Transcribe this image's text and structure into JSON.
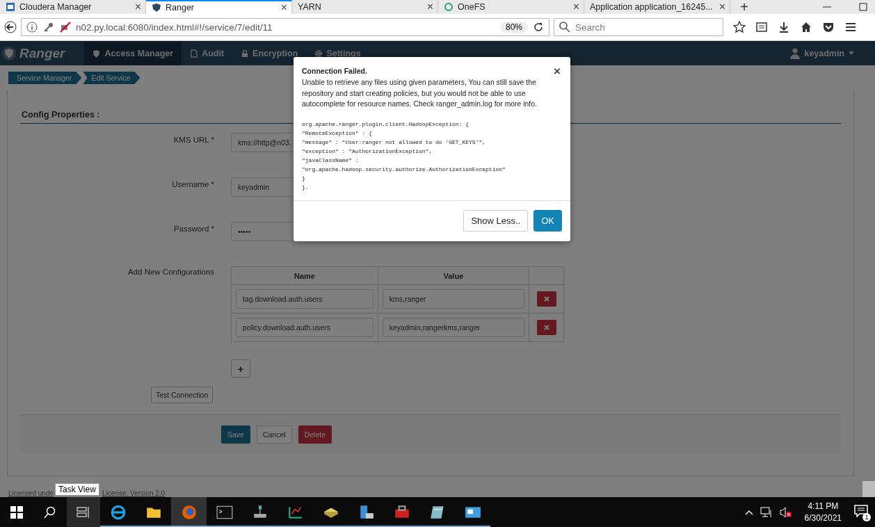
{
  "browser": {
    "tabs": [
      {
        "label": "Cloudera Manager",
        "selected": false,
        "close": "×"
      },
      {
        "label": "Ranger",
        "selected": true,
        "close": "×"
      },
      {
        "label": "YARN",
        "selected": false,
        "close": "×"
      },
      {
        "label": "OneFS",
        "selected": false,
        "close": "×"
      },
      {
        "label": "Application application_16245...",
        "selected": false,
        "close": "×"
      }
    ],
    "new_tab": "+",
    "url": "n02.py.local:6080/index.html#!/service/7/edit/11",
    "zoom": "80%",
    "search": {
      "placeholder": "Search"
    }
  },
  "navbar": {
    "brand": "Ranger",
    "items": [
      {
        "label": "Access Manager",
        "selected": true
      },
      {
        "label": "Audit",
        "selected": false
      },
      {
        "label": "Encryption",
        "selected": false
      },
      {
        "label": "Settings",
        "selected": false
      }
    ],
    "user": "keyadmin"
  },
  "breadcrumbs": [
    "Service Manager",
    "Edit Service"
  ],
  "section_title": "Config Properties :",
  "fields": [
    {
      "label": "KMS URL *",
      "value": "kms://http@n03."
    },
    {
      "label": "Username *",
      "value": "keyadmin"
    },
    {
      "label": "Password *",
      "value": "•••••"
    }
  ],
  "configs": {
    "label": "Add New Configurations",
    "columns": [
      "Name",
      "Value"
    ],
    "rows": [
      {
        "name": "tag.download.auth.users",
        "value": "kms,ranger"
      },
      {
        "name": "policy.download.auth.users",
        "value": "keyadmin,rangerkms,ranger"
      }
    ],
    "add": "+"
  },
  "test_connection": "Test Connection",
  "actions": [
    "Save",
    "Cancel",
    "Delete"
  ],
  "footer": [
    "Licensed unde",
    "License, Version 2.0"
  ],
  "modal": {
    "title": "Connection Failed.",
    "close": "×",
    "message": "Unable to retrieve any files using given parameters, You can still save the repository and start creating policies, but you would not be able to use autocomplete for resource names. Check ranger_admin.log for more info.",
    "details": [
      "org.apache.ranger.plugin.client.HadoopException: {",
      "\"RemoteException\" : {",
      "\"message\" : \"User:ranger not allowed to do 'GET_KEYS'\",",
      "\"exception\" : \"AuthorizationException\",",
      "\"javaClassName\" : ",
      "\"org.apache.hadoop.security.authorize.AuthorizationException\"",
      "}",
      "}."
    ],
    "buttons": [
      "Show Less..",
      "OK"
    ]
  },
  "tooltip": "Task View",
  "taskbar": {
    "time": "4:11 PM",
    "date": "6/30/2021",
    "notifications": "1"
  }
}
